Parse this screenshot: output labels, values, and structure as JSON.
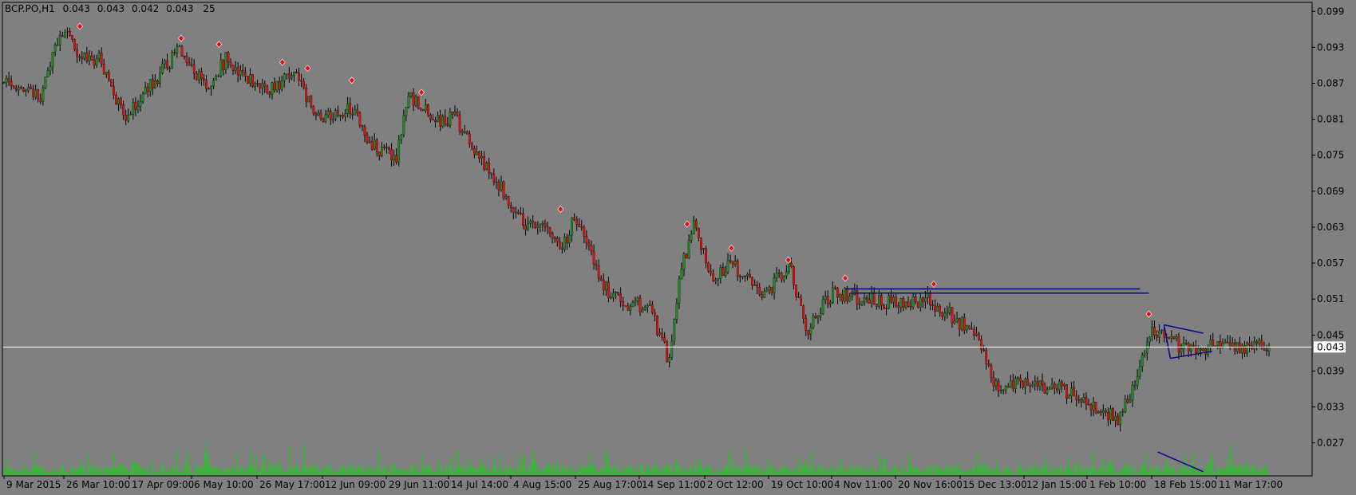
{
  "header": {
    "symbol": "BCP.PO,H1",
    "open": "0.043",
    "high": "0.043",
    "low": "0.042",
    "close": "0.043",
    "volume": "25"
  },
  "colors": {
    "background": "#808080",
    "up_candle": "#1f8b1f",
    "down_candle": "#e01010",
    "wick": "#000000",
    "volume": "#00e000",
    "trendline": "#0b0b8c",
    "current_price_line": "#ffffff",
    "fractal_marker": "#e01010"
  },
  "chart_data": {
    "type": "candlestick",
    "title": "BCP.PO,H1",
    "ylim": [
      0.0215,
      0.1005
    ],
    "y_ticks": [
      "0.099",
      "0.093",
      "0.087",
      "0.081",
      "0.075",
      "0.069",
      "0.063",
      "0.057",
      "0.051",
      "0.045",
      "0.039",
      "0.033",
      "0.027"
    ],
    "current_price": 0.043,
    "current_price_label": "0.043",
    "x_tick_labels": [
      "9 Mar 2015",
      "26 Mar 10:00",
      "17 Apr 09:00",
      "6 May 10:00",
      "26 May 17:00",
      "12 Jun 09:00",
      "29 Jun 11:00",
      "14 Jul 14:00",
      "4 Aug 15:00",
      "25 Aug 17:00",
      "14 Sep 11:00",
      "2 Oct 12:00",
      "19 Oct 10:00",
      "4 Nov 11:00",
      "20 Nov 16:00",
      "15 Dec 13:00",
      "12 Jan 15:00",
      "1 Feb 10:00",
      "18 Feb 15:00",
      "11 Mar 17:00"
    ],
    "price_path": [
      [
        0,
        0.087
      ],
      [
        0.03,
        0.085
      ],
      [
        0.045,
        0.096
      ],
      [
        0.06,
        0.092
      ],
      [
        0.075,
        0.091
      ],
      [
        0.095,
        0.081
      ],
      [
        0.11,
        0.085
      ],
      [
        0.14,
        0.093
      ],
      [
        0.16,
        0.086
      ],
      [
        0.175,
        0.091
      ],
      [
        0.205,
        0.086
      ],
      [
        0.23,
        0.088
      ],
      [
        0.25,
        0.081
      ],
      [
        0.275,
        0.083
      ],
      [
        0.29,
        0.077
      ],
      [
        0.31,
        0.074
      ],
      [
        0.32,
        0.085
      ],
      [
        0.345,
        0.08
      ],
      [
        0.355,
        0.082
      ],
      [
        0.375,
        0.075
      ],
      [
        0.395,
        0.069
      ],
      [
        0.415,
        0.063
      ],
      [
        0.435,
        0.062
      ],
      [
        0.44,
        0.058
      ],
      [
        0.45,
        0.065
      ],
      [
        0.465,
        0.059
      ],
      [
        0.47,
        0.054
      ],
      [
        0.49,
        0.05
      ],
      [
        0.51,
        0.05
      ],
      [
        0.525,
        0.041
      ],
      [
        0.535,
        0.055
      ],
      [
        0.545,
        0.064
      ],
      [
        0.56,
        0.054
      ],
      [
        0.575,
        0.057
      ],
      [
        0.6,
        0.051
      ],
      [
        0.62,
        0.057
      ],
      [
        0.635,
        0.046
      ],
      [
        0.655,
        0.052
      ],
      [
        0.685,
        0.051
      ],
      [
        0.71,
        0.05
      ],
      [
        0.73,
        0.051
      ],
      [
        0.75,
        0.048
      ],
      [
        0.77,
        0.045
      ],
      [
        0.785,
        0.036
      ],
      [
        0.81,
        0.037
      ],
      [
        0.835,
        0.036
      ],
      [
        0.865,
        0.033
      ],
      [
        0.88,
        0.031
      ],
      [
        0.89,
        0.035
      ],
      [
        0.905,
        0.045
      ],
      [
        0.915,
        0.046
      ],
      [
        0.93,
        0.043
      ]
    ],
    "fractal_highs": [
      [
        0.06,
        0.0965
      ],
      [
        0.14,
        0.0945
      ],
      [
        0.17,
        0.0935
      ],
      [
        0.22,
        0.0905
      ],
      [
        0.24,
        0.0895
      ],
      [
        0.275,
        0.0875
      ],
      [
        0.33,
        0.0855
      ],
      [
        0.44,
        0.066
      ],
      [
        0.54,
        0.0635
      ],
      [
        0.575,
        0.0595
      ],
      [
        0.62,
        0.0575
      ],
      [
        0.665,
        0.0545
      ],
      [
        0.735,
        0.0535
      ],
      [
        0.905,
        0.0485
      ]
    ],
    "fractal_lows": [],
    "trendlines": [
      {
        "name": "resistance-upper",
        "x1": 0.665,
        "y1": 0.0527,
        "x2": 0.898,
        "y2": 0.0527
      },
      {
        "name": "resistance-lower",
        "x1": 0.669,
        "y1": 0.052,
        "x2": 0.905,
        "y2": 0.052
      },
      {
        "name": "triangle-top",
        "x1": 0.917,
        "y1": 0.0467,
        "x2": 0.948,
        "y2": 0.0453
      },
      {
        "name": "triangle-bottom",
        "x1": 0.922,
        "y1": 0.0411,
        "x2": 0.955,
        "y2": 0.0423
      },
      {
        "name": "triangle-left",
        "x1": 0.917,
        "y1": 0.0467,
        "x2": 0.922,
        "y2": 0.0411
      },
      {
        "name": "volume-trend",
        "x1": 0.912,
        "y1": 0.0255,
        "x2": 0.948,
        "y2": 0.0222
      }
    ],
    "grid": false,
    "legend": "none"
  }
}
